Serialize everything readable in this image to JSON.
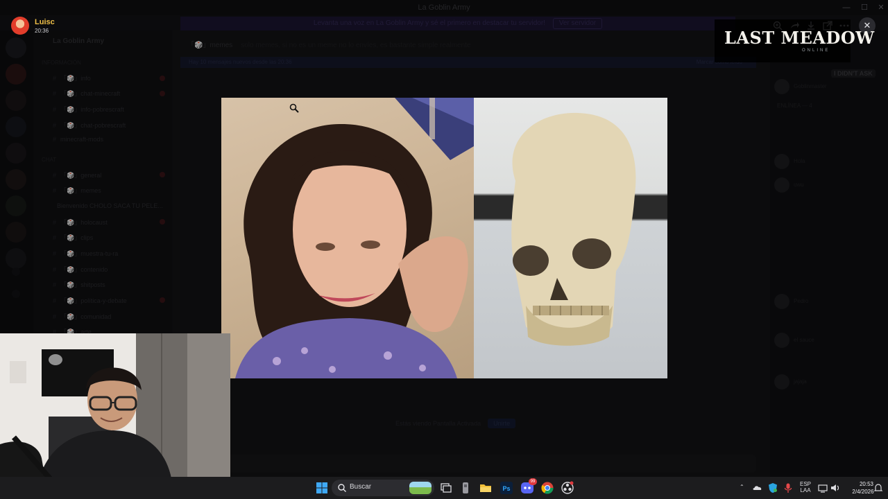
{
  "window": {
    "title": "La Goblin Army"
  },
  "banner": {
    "text": "Levanta una voz en La Goblin Army y sé el primero en destacar tu servidor!",
    "button": "Ver servidor"
  },
  "server": {
    "name": "La Goblin Army",
    "categories": [
      "INFORMACIÓN",
      "CHAT"
    ],
    "channels": [
      {
        "label": "「🎲」info"
      },
      {
        "label": "「🎲」chat-minecraft"
      },
      {
        "label": "「🎲」info-pobrescraft"
      },
      {
        "label": "「🎲」chat-pobrescraft"
      },
      {
        "label": "minecraft-mods"
      },
      {
        "label": "「🎲」general"
      },
      {
        "label": "「🎲」memes"
      },
      {
        "label": "Bienvenido CHOLO SACA TU PELE..."
      },
      {
        "label": "「🎲」holocaust"
      },
      {
        "label": "「🎲」clips"
      },
      {
        "label": "「🎲」muestra-tu-ra"
      },
      {
        "label": "「🎲」contenido"
      },
      {
        "label": "「🎲」shitposts"
      },
      {
        "label": "「🎲」política-y-debate"
      },
      {
        "label": "「🎲」comunidad"
      },
      {
        "label": "「🎲」arte"
      }
    ]
  },
  "chat": {
    "header": "「🎲」memes",
    "topic": "solo memes, si no es un meme no lo envíes, es bastante simple realmente",
    "new_messages": "Hay 10 mensajes nuevos desde las 20:36",
    "mark_read": "Marcar como leído",
    "voice_card": "Estás viendo Pantalla Activada",
    "voice_join": "Unirte"
  },
  "members": {
    "badge": "I DIDN'T ASK",
    "names": [
      "Goblinmaster",
      "ENLÍNEA — 4",
      "Hola",
      "uwu",
      "Pedro",
      "el sauce",
      "jajaja"
    ]
  },
  "post": {
    "author": "Luisc",
    "time": "20:36"
  },
  "viewer": {
    "toolbar_icons": [
      "zoom-in-icon",
      "forward-icon",
      "download-icon",
      "open-external-icon",
      "more-icon"
    ],
    "close": "✕"
  },
  "stream_logo": {
    "main": "LAST MEADOW",
    "sub": "ONLINE"
  },
  "taskbar": {
    "search_placeholder": "Buscar",
    "discord_badge": "99",
    "lang_top": "ESP",
    "lang_bottom": "LAA",
    "time": "20:53",
    "date": "2/4/2026"
  },
  "colors": {
    "author_name": "#f0c048",
    "close_button_bg": "#2b2b30",
    "taskbar_bg": "#1c1c1e",
    "windows_blue": "#3fa9f5"
  }
}
